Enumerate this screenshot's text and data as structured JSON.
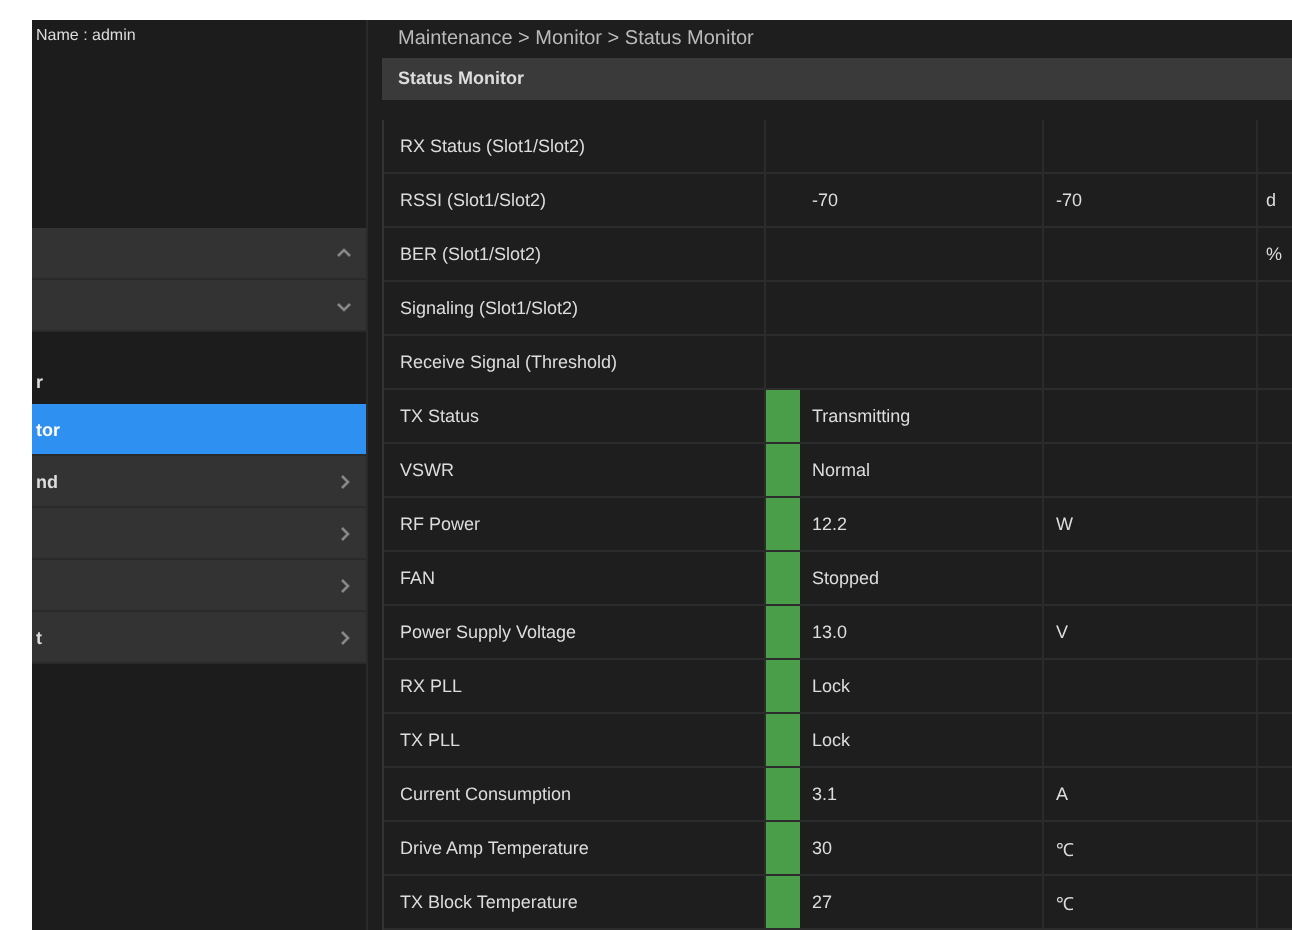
{
  "user": {
    "name": "Name : admin"
  },
  "breadcrumb": "Maintenance > Monitor > Status Monitor",
  "sidebar": {
    "items": [
      {
        "kind": "expanded",
        "selected": false
      },
      {
        "kind": "collapsed",
        "selected": false
      },
      {
        "label": "r",
        "kind": "heading",
        "selected": false
      },
      {
        "label": "tor",
        "kind": "link",
        "selected": true
      },
      {
        "label": "nd",
        "kind": "submenu",
        "selected": false
      },
      {
        "kind": "submenu",
        "selected": false
      },
      {
        "kind": "submenu",
        "selected": false
      },
      {
        "label": "t",
        "kind": "submenu",
        "selected": false
      }
    ]
  },
  "panel": {
    "title": "Status Monitor"
  },
  "table": {
    "rows": [
      {
        "label": "RX Status (Slot1/Slot2)",
        "color": null,
        "cells": []
      },
      {
        "label": "RSSI (Slot1/Slot2)",
        "color": null,
        "cells": [
          "-70",
          "-70",
          "d"
        ]
      },
      {
        "label": "BER (Slot1/Slot2)",
        "color": null,
        "cells": [
          "",
          "",
          "%"
        ]
      },
      {
        "label": "Signaling (Slot1/Slot2)",
        "color": null,
        "cells": []
      },
      {
        "label": "Receive Signal (Threshold)",
        "color": null,
        "cells": []
      },
      {
        "label": "TX Status",
        "color": "#4a9e4a",
        "cells": [
          "Transmitting"
        ]
      },
      {
        "label": "VSWR",
        "color": "#4a9e4a",
        "cells": [
          "Normal"
        ]
      },
      {
        "label": "RF Power",
        "color": "#4a9e4a",
        "cells": [
          "12.2",
          "W"
        ]
      },
      {
        "label": "FAN",
        "color": "#4a9e4a",
        "cells": [
          "Stopped"
        ]
      },
      {
        "label": "Power Supply Voltage",
        "color": "#4a9e4a",
        "cells": [
          "13.0",
          "V"
        ]
      },
      {
        "label": "RX PLL",
        "color": "#4a9e4a",
        "cells": [
          "Lock"
        ]
      },
      {
        "label": "TX PLL",
        "color": "#4a9e4a",
        "cells": [
          "Lock"
        ]
      },
      {
        "label": "Current Consumption",
        "color": "#4a9e4a",
        "cells": [
          "3.1",
          "A"
        ]
      },
      {
        "label": "Drive Amp Temperature",
        "color": "#4a9e4a",
        "cells": [
          "30",
          "℃"
        ]
      },
      {
        "label": "TX Block Temperature",
        "color": "#4a9e4a",
        "cells": [
          "27",
          "℃"
        ]
      }
    ]
  }
}
